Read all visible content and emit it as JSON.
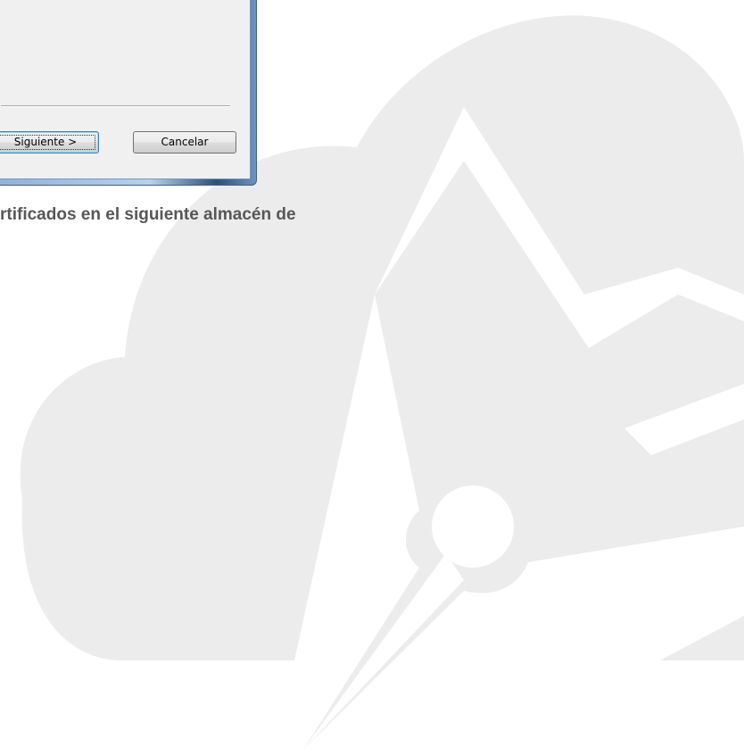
{
  "dialog": {
    "next_button_label": "Siguiente >",
    "cancel_button_label": "Cancelar"
  },
  "heading_text": "rtificados en el siguiente almacén de",
  "watermark": {
    "icon": "cloud-mountain-logo",
    "color": "#eaeaea"
  }
}
